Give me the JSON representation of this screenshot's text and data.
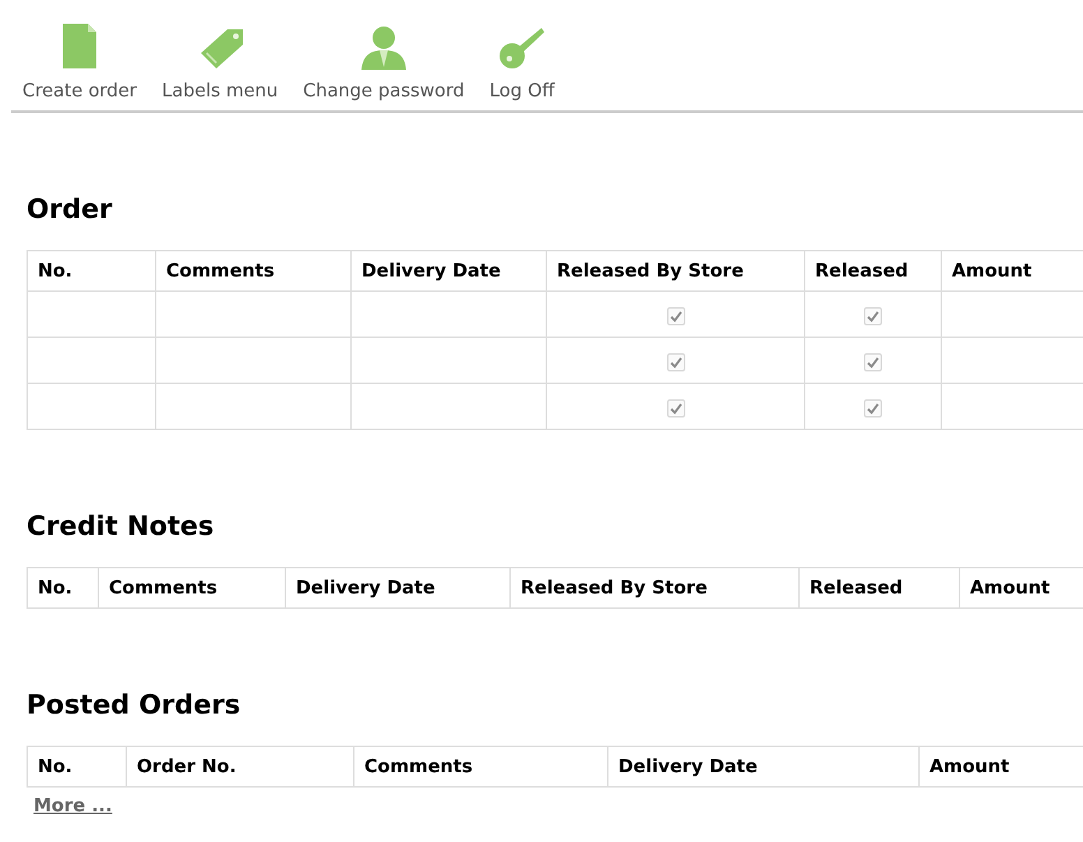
{
  "toolbar": [
    {
      "kind": "document",
      "label": "Create order"
    },
    {
      "kind": "tag",
      "label": "Labels menu"
    },
    {
      "kind": "user",
      "label": "Change password"
    },
    {
      "kind": "key",
      "label": "Log Off"
    }
  ],
  "sections": [
    {
      "title": "Order",
      "columns": [
        "No.",
        "Comments",
        "Delivery Date",
        "Released By Store",
        "Released",
        "Amount"
      ],
      "rows": [
        {
          "released_by_store": {
            "checked": true,
            "disabled": true
          },
          "released": {
            "checked": true,
            "disabled": true
          }
        },
        {
          "released_by_store": {
            "checked": true,
            "disabled": true
          },
          "released": {
            "checked": true,
            "disabled": true
          }
        },
        {
          "released_by_store": {
            "checked": true,
            "disabled": true
          },
          "released": {
            "checked": true,
            "disabled": true
          }
        }
      ]
    },
    {
      "title": "Credit Notes",
      "columns": [
        "No.",
        "Comments",
        "Delivery Date",
        "Released By Store",
        "Released",
        "Amount"
      ]
    },
    {
      "title": "Posted Orders",
      "columns": [
        "No.",
        "Order No.",
        "Comments",
        "Delivery Date",
        "Amount"
      ],
      "more_link": "More ..."
    }
  ]
}
